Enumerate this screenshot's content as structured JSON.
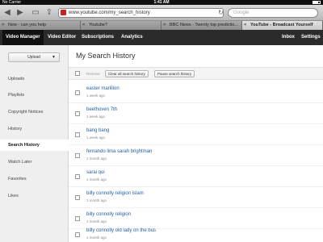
{
  "status_bar": {
    "carrier": "No Carrier",
    "time": "1:41 AM"
  },
  "browser": {
    "url": "www.youtube.com/my_search_history",
    "search_placeholder": "Google",
    "tabs": [
      {
        "label": "New - can you help",
        "active": false
      },
      {
        "label": "Youtube?",
        "active": false
      },
      {
        "label": "BBC News - Twenty top predictio...",
        "active": false
      },
      {
        "label": "YouTube - Broadcast Yourself",
        "active": true
      }
    ]
  },
  "ytnav": {
    "items": [
      "Video Manager",
      "Video Editor",
      "Subscriptions",
      "Analytics"
    ],
    "inbox": "Inbox",
    "settings": "Settings"
  },
  "sidebar": {
    "upload_label": "Upload",
    "items": [
      "Uploads",
      "Playlists",
      "Copyright Notices",
      "History",
      "Search History",
      "Watch Later",
      "Favorites",
      "Likes"
    ],
    "active_index": 4
  },
  "main": {
    "title": "My Search History",
    "remove_label": "Remove",
    "clear_label": "Clear all search history",
    "pause_label": "Pause search history",
    "entries": [
      {
        "query": "easter marillion",
        "when": "1 week ago"
      },
      {
        "query": "beethoven 7th",
        "when": "1 week ago"
      },
      {
        "query": "bang bang",
        "when": "1 week ago"
      },
      {
        "query": "fernando lima sarah brightman",
        "when": "1 month ago"
      },
      {
        "query": "sarai qui",
        "when": "1 month ago"
      },
      {
        "query": "billy connolly religion islam",
        "when": "1 month ago"
      },
      {
        "query": "billy connolly religion",
        "when": "1 month ago"
      },
      {
        "query": "billy connolly old lady on the bus",
        "when": "1 month ago"
      }
    ]
  },
  "colors": {
    "link": "#1f5fa8",
    "nav_bg": "#2b2b2b",
    "favicon": "#cc2020"
  }
}
